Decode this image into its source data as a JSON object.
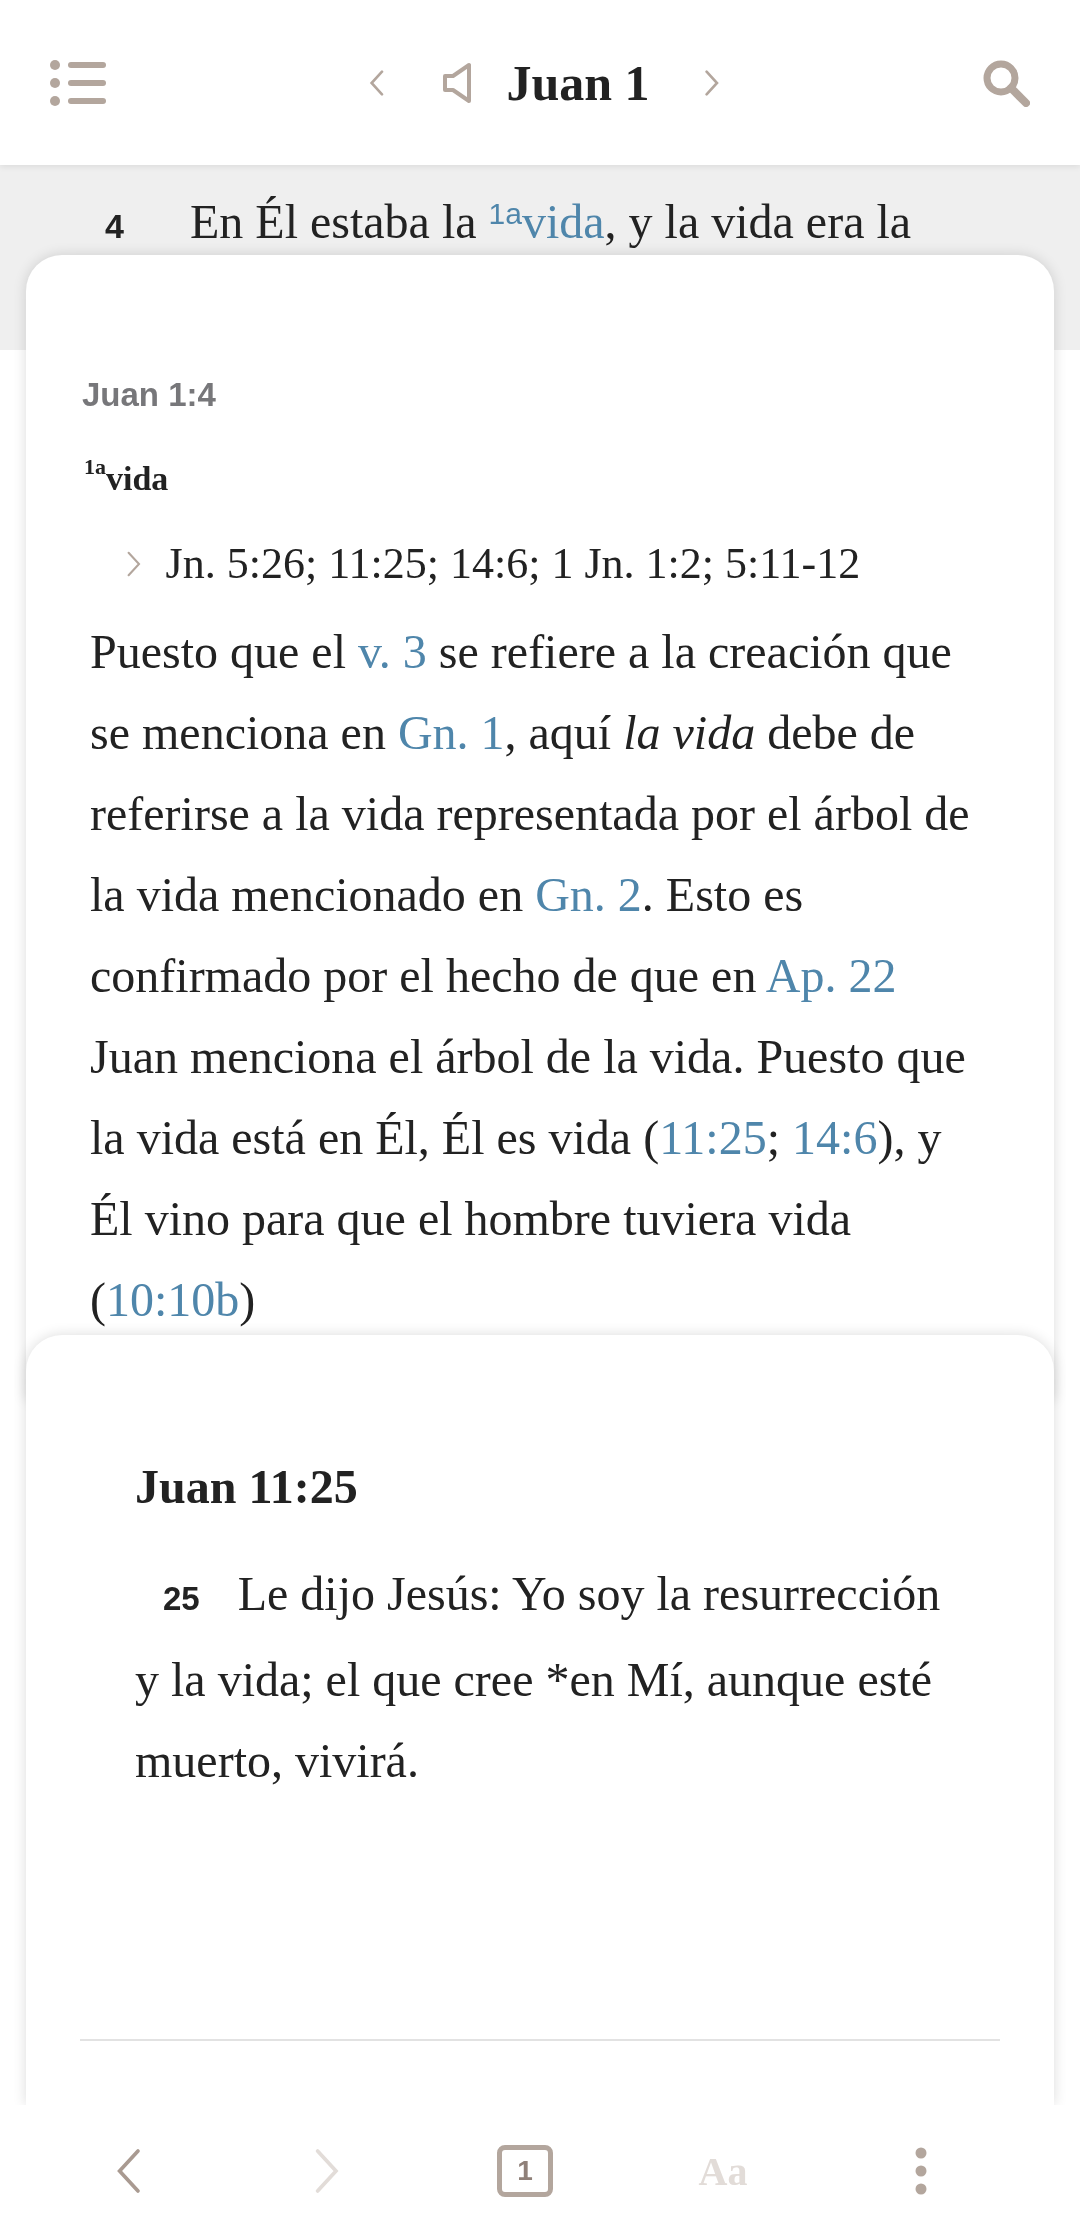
{
  "header": {
    "title": "Juan 1"
  },
  "verse": {
    "number": "4",
    "before": "En Él estaba la ",
    "note_mark": "1a",
    "link": "vida",
    "after": ", y la vida era la"
  },
  "note_card": {
    "reference": "Juan 1:4",
    "note_mark": "1a",
    "word": "vida",
    "cross_refs": "Jn. 5:26; 11:25; 14:6; 1 Jn. 1:2; 5:11-12",
    "paragraph": [
      {
        "kind": "plain",
        "text": "Puesto que el "
      },
      {
        "kind": "link",
        "text": "v. 3"
      },
      {
        "kind": "plain",
        "text": " se refiere a la creación que se menciona en "
      },
      {
        "kind": "link",
        "text": "Gn. 1"
      },
      {
        "kind": "plain",
        "text": ", aquí *la vida* debe de referirse a la vida representada por el árbol de la vida mencionado en "
      },
      {
        "kind": "link",
        "text": "Gn. 2"
      },
      {
        "kind": "plain",
        "text": ". Esto es confirmado por el hecho de que en "
      },
      {
        "kind": "link",
        "text": "Ap. 22"
      },
      {
        "kind": "plain",
        "text": " Juan menciona el árbol de la vida. Puesto que la vida está en Él, Él es vida ("
      },
      {
        "kind": "link",
        "text": "11:25"
      },
      {
        "kind": "plain",
        "text": "; "
      },
      {
        "kind": "link",
        "text": "14:6"
      },
      {
        "kind": "plain",
        "text": "), y Él vino para que el hombre tuviera vida ("
      },
      {
        "kind": "link",
        "text": "10:10b"
      },
      {
        "kind": "plain",
        "text": ")"
      }
    ]
  },
  "verse_card": {
    "reference": "Juan 11:25",
    "number": "25",
    "text": "Le dijo Jesús: Yo soy la resurrección y la vida; el que cree *en Mí, aunque esté muerto, vivirá."
  },
  "bottom_bar": {
    "back_disabled": false,
    "forward_disabled": true,
    "chapter": "1",
    "font_button": "Aa",
    "font_disabled": true
  }
}
